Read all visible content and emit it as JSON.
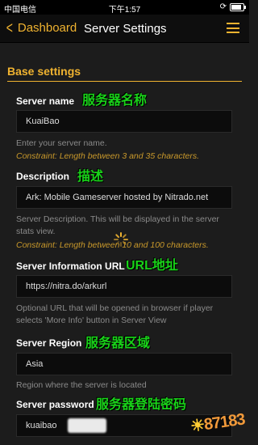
{
  "status_bar": {
    "carrier": "中国电信",
    "time": "下午1:57"
  },
  "nav": {
    "back_label": "Dashboard",
    "title": "Server Settings"
  },
  "section": {
    "title": "Base settings"
  },
  "fields": {
    "server_name": {
      "label": "Server name",
      "value": "KuaiBao",
      "help": "Enter your server name.",
      "constraint": "Constraint: Length between 3 and 35 characters.",
      "annotation": "服务器名称"
    },
    "description": {
      "label": "Description",
      "value": "Ark: Mobile Gameserver hosted by Nitrado.net",
      "help": "Server Description. This will be displayed in the server stats view.",
      "constraint": "Constraint: Length between 10 and 100 characters.",
      "annotation": "描述"
    },
    "info_url": {
      "label": "Server Information URL",
      "value": "https://nitra.do/arkurl",
      "help": "Optional URL that will be opened in browser if player selects 'More Info' button in Server View",
      "annotation": "URL地址"
    },
    "region": {
      "label": "Server Region",
      "value": "Asia",
      "help": "Region where the server is located",
      "annotation": "服务器区域"
    },
    "password": {
      "label": "Server password",
      "value": "kuaibao",
      "annotation": "服务器登陆密码"
    }
  },
  "watermark": "87183",
  "colors": {
    "accent": "#f0b330",
    "background": "#1c1c1c",
    "annotation": "#19d219",
    "constraint": "#c8982b"
  }
}
